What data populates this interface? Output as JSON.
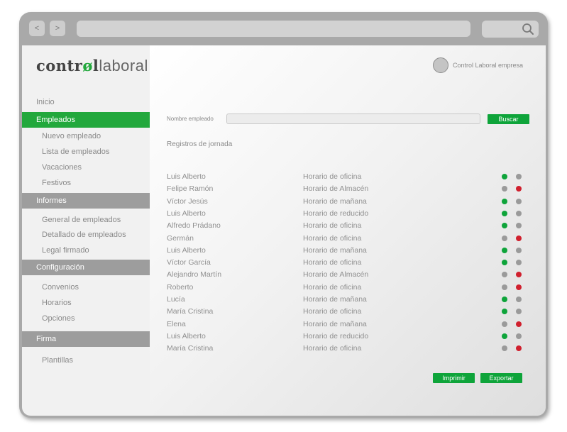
{
  "colors": {
    "green": "#0ea43a",
    "gray": "#9a9a9a",
    "red": "#d0202e"
  },
  "toolbar": {
    "back_label": "<",
    "forward_label": ">"
  },
  "logo": {
    "bold": "contr",
    "o": "ø",
    "bold2": "l",
    "light": "laboral"
  },
  "sidebar": {
    "inicio": "Inicio",
    "empleados": "Empleados",
    "nuevo_empleado": "Nuevo empleado",
    "lista_empleados": "Lista de empleados",
    "vacaciones": "Vacaciones",
    "festivos": "Festivos",
    "informes": "Informes",
    "general_empleados": "General de empleados",
    "detallado_empleados": "Detallado de empleados",
    "legal_firmado": "Legal firmado",
    "configuracion": "Configuración",
    "convenios": "Convenios",
    "horarios": "Horarios",
    "opciones": "Opciones",
    "firma": "Firma",
    "plantillas": "Plantillas"
  },
  "header": {
    "company": "Control Laboral empresa"
  },
  "search": {
    "label": "Nombre empleado",
    "value": "",
    "button": "Buscar"
  },
  "registros": {
    "title": "Registros de jornada",
    "rows": [
      {
        "name": "Luis Alberto",
        "schedule": "Horario de oficina",
        "status": [
          "green",
          "gray"
        ]
      },
      {
        "name": "Felipe Ramón",
        "schedule": "Horario de Almacén",
        "status": [
          "gray",
          "red"
        ]
      },
      {
        "name": "Víctor Jesús",
        "schedule": "Horario de mañana",
        "status": [
          "green",
          "gray"
        ]
      },
      {
        "name": "Luis Alberto",
        "schedule": "Horario de reducido",
        "status": [
          "green",
          "gray"
        ]
      },
      {
        "name": "Alfredo Prádano",
        "schedule": "Horario de oficina",
        "status": [
          "green",
          "gray"
        ]
      },
      {
        "name": "Germán",
        "schedule": "Horario de oficina",
        "status": [
          "gray",
          "red"
        ]
      },
      {
        "name": "Luis Alberto",
        "schedule": "Horario de mañana",
        "status": [
          "green",
          "gray"
        ]
      },
      {
        "name": "Víctor García",
        "schedule": "Horario de oficina",
        "status": [
          "green",
          "gray"
        ]
      },
      {
        "name": "Alejandro Martín",
        "schedule": "Horario de Almacén",
        "status": [
          "gray",
          "red"
        ]
      },
      {
        "name": "Roberto",
        "schedule": "Horario de oficina",
        "status": [
          "gray",
          "red"
        ]
      },
      {
        "name": "Lucía",
        "schedule": "Horario de mañana",
        "status": [
          "green",
          "gray"
        ]
      },
      {
        "name": "María Cristina",
        "schedule": "Horario de oficina",
        "status": [
          "green",
          "gray"
        ]
      },
      {
        "name": "Elena",
        "schedule": "Horario de mañana",
        "status": [
          "gray",
          "red"
        ]
      },
      {
        "name": "Luis Alberto",
        "schedule": "Horario de reducido",
        "status": [
          "green",
          "gray"
        ]
      },
      {
        "name": "María Cristina",
        "schedule": "Horario de oficina",
        "status": [
          "gray",
          "red"
        ]
      }
    ]
  },
  "actions": {
    "print": "Imprimir",
    "export": "Exportar"
  }
}
